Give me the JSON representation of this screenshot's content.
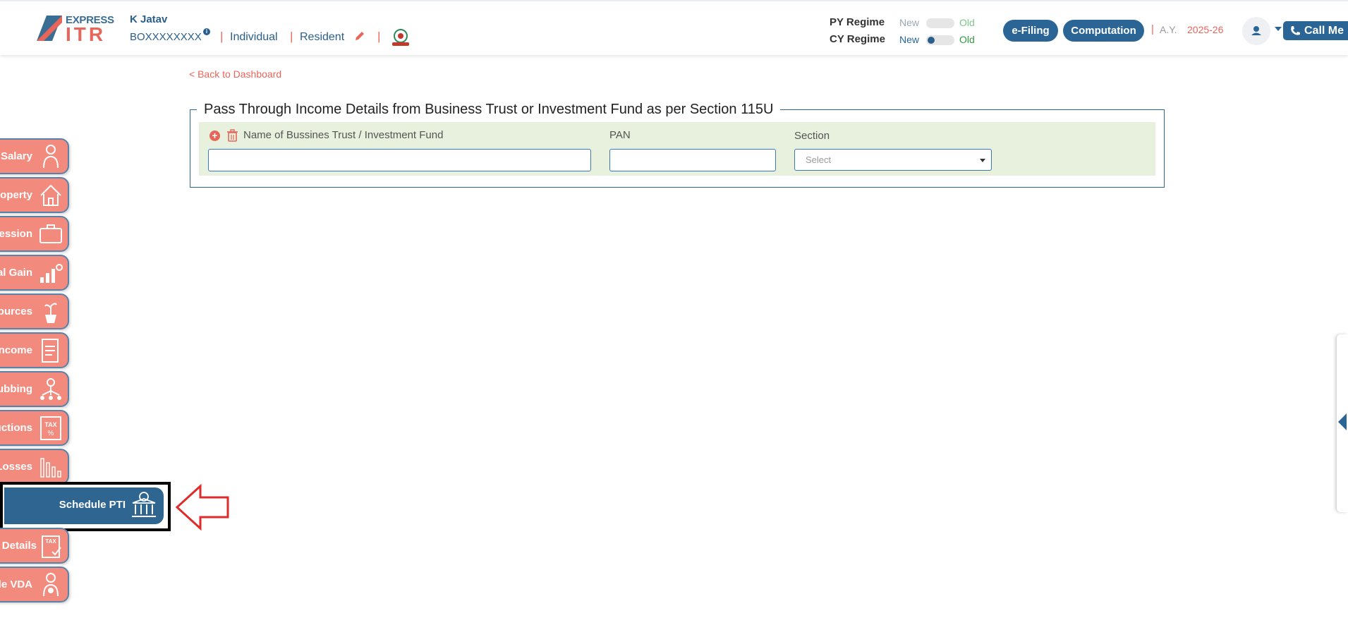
{
  "header": {
    "logo": {
      "express": "EXPRESS",
      "itr": "ITR"
    },
    "user": {
      "name": "K Jatav",
      "pan": "BOXXXXXXXX",
      "info_icon": "i",
      "type": "Individual",
      "residency": "Resident"
    },
    "regime": {
      "py": {
        "label": "PY Regime",
        "new": "New",
        "old": "Old",
        "selected": "none"
      },
      "cy": {
        "label": "CY Regime",
        "new": "New",
        "old": "Old",
        "selected": "new"
      }
    },
    "buttons": {
      "efiling": "e-Filing",
      "computation": "Computation"
    },
    "ay": {
      "label": "A.Y.",
      "value": "2025-26"
    },
    "callme": "Call Me"
  },
  "back_link": "< Back to Dashboard",
  "section": {
    "title": "Pass Through Income Details from Business Trust or Investment Fund as per Section 115U",
    "columns": {
      "name": "Name of Bussines Trust / Investment Fund",
      "pan": "PAN",
      "section": "Section"
    },
    "row": {
      "name_value": "",
      "pan_value": "",
      "section_placeholder": "Select"
    }
  },
  "sidenav": {
    "items": [
      {
        "label": "Salary",
        "icon": "salary-person-icon"
      },
      {
        "label": "roperty",
        "icon": "house-icon"
      },
      {
        "label": "fession",
        "icon": "briefcase-icon"
      },
      {
        "label": "al Gain",
        "icon": "growth-chart-icon"
      },
      {
        "label": "Sources",
        "icon": "plant-pot-icon"
      },
      {
        "label": "ncome",
        "icon": "tax-document-icon"
      },
      {
        "label": "ubbing",
        "icon": "person-network-icon"
      },
      {
        "label": "uctions",
        "icon": "tax-percent-icon"
      },
      {
        "label": "Losses",
        "icon": "declining-chart-icon"
      },
      {
        "label": "Schedule PTI",
        "icon": "bank-building-icon",
        "active": true
      },
      {
        "label": "t Details",
        "icon": "tax-clipboard-icon"
      },
      {
        "label": "ule VDA",
        "icon": "person-coin-icon"
      }
    ]
  },
  "colors": {
    "accent": "#2a6596",
    "coral": "#f28a7d",
    "row_bg": "#e7f1de",
    "red": "#e8655a"
  }
}
